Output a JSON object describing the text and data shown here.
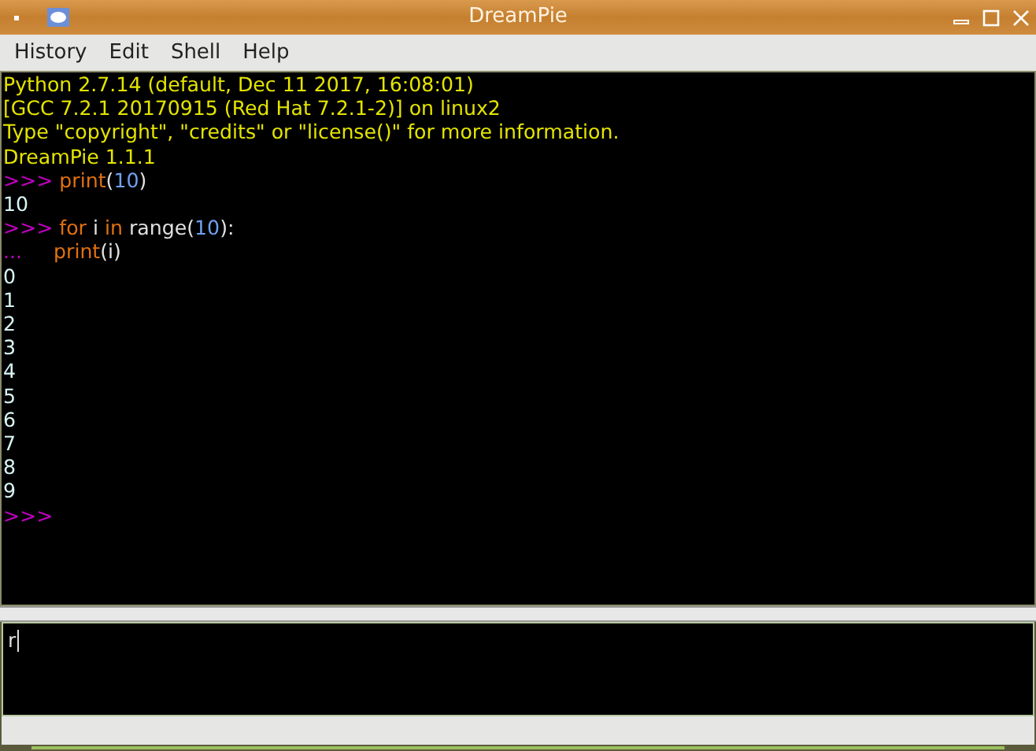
{
  "window": {
    "title": "DreamPie"
  },
  "menu": [
    {
      "label": "History"
    },
    {
      "label": "Edit"
    },
    {
      "label": "Shell"
    },
    {
      "label": "Help"
    }
  ],
  "output": [
    [
      {
        "text": "Python 2.7.14 (default, Dec 11 2017, 16:08:01)",
        "kind": "banner"
      }
    ],
    [
      {
        "text": "[GCC 7.2.1 20170915 (Red Hat 7.2.1-2)] on linux2",
        "kind": "banner"
      }
    ],
    [
      {
        "text": "Type \"copyright\", \"credits\" or \"license()\" for more information.",
        "kind": "banner"
      }
    ],
    [
      {
        "text": "DreamPie 1.1.1",
        "kind": "banner"
      }
    ],
    [
      {
        "text": ">>> ",
        "kind": "prompt"
      },
      {
        "text": "print",
        "kind": "keyword"
      },
      {
        "text": "(",
        "kind": "plain"
      },
      {
        "text": "10",
        "kind": "number"
      },
      {
        "text": ")",
        "kind": "plain"
      }
    ],
    [
      {
        "text": "10",
        "kind": "result"
      }
    ],
    [
      {
        "text": ">>> ",
        "kind": "prompt"
      },
      {
        "text": "for",
        "kind": "keyword"
      },
      {
        "text": " i ",
        "kind": "plain"
      },
      {
        "text": "in",
        "kind": "keyword"
      },
      {
        "text": " range(",
        "kind": "plain"
      },
      {
        "text": "10",
        "kind": "number"
      },
      {
        "text": "):",
        "kind": "plain"
      }
    ],
    [
      {
        "text": "...     ",
        "kind": "prompt"
      },
      {
        "text": "print",
        "kind": "keyword"
      },
      {
        "text": "(i)",
        "kind": "plain"
      }
    ],
    [
      {
        "text": "0",
        "kind": "result"
      }
    ],
    [
      {
        "text": "1",
        "kind": "result"
      }
    ],
    [
      {
        "text": "2",
        "kind": "result"
      }
    ],
    [
      {
        "text": "3",
        "kind": "result"
      }
    ],
    [
      {
        "text": "4",
        "kind": "result"
      }
    ],
    [
      {
        "text": "5",
        "kind": "result"
      }
    ],
    [
      {
        "text": "6",
        "kind": "result"
      }
    ],
    [
      {
        "text": "7",
        "kind": "result"
      }
    ],
    [
      {
        "text": "8",
        "kind": "result"
      }
    ],
    [
      {
        "text": "9",
        "kind": "result"
      }
    ],
    [
      {
        "text": ">>>",
        "kind": "prompt"
      }
    ]
  ],
  "input": {
    "value": "r"
  }
}
